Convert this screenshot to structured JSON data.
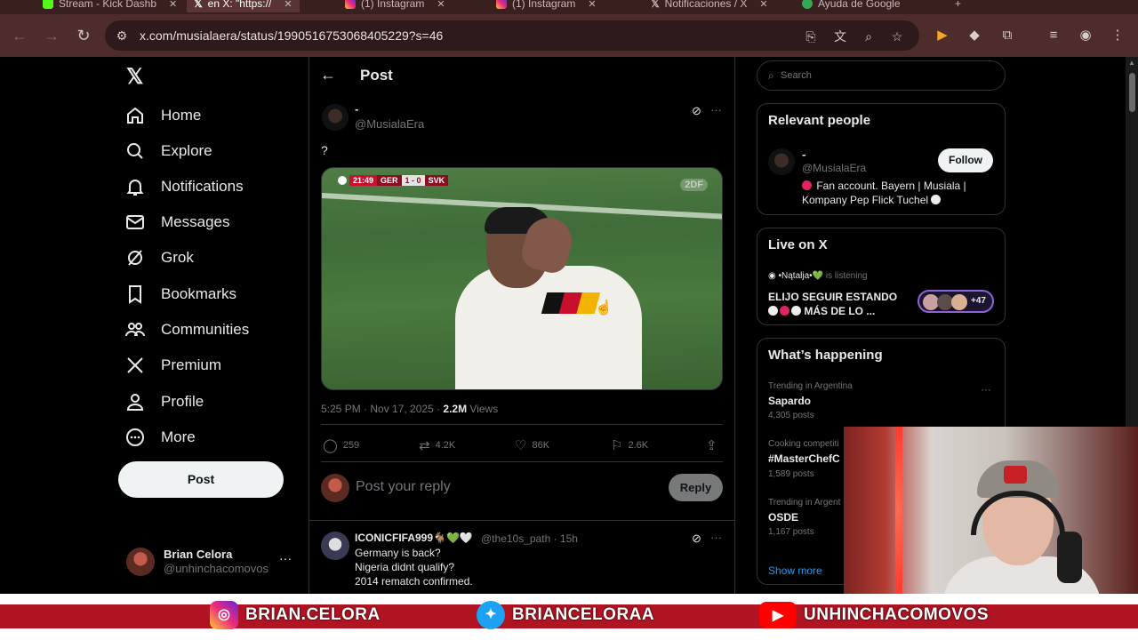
{
  "browser": {
    "tabs": [
      {
        "label": "Stream - Kick Dashb"
      },
      {
        "label": "en X: \"https://"
      },
      {
        "label": "(1) Instagram"
      },
      {
        "label": "(1) Instagram"
      },
      {
        "label": "Notificaciones / X"
      },
      {
        "label": "Ayuda de Google"
      }
    ],
    "url": "x.com/musialaera/status/1990516753068405229?s=46"
  },
  "nav": {
    "items": [
      {
        "label": "Home",
        "icon": "home-icon"
      },
      {
        "label": "Explore",
        "icon": "search-icon"
      },
      {
        "label": "Notifications",
        "icon": "bell-icon"
      },
      {
        "label": "Messages",
        "icon": "mail-icon"
      },
      {
        "label": "Grok",
        "icon": "grok-icon"
      },
      {
        "label": "Bookmarks",
        "icon": "bookmark-icon"
      },
      {
        "label": "Communities",
        "icon": "communities-icon"
      },
      {
        "label": "Premium",
        "icon": "x-logo-icon"
      },
      {
        "label": "Profile",
        "icon": "person-icon"
      },
      {
        "label": "More",
        "icon": "more-circle-icon"
      }
    ],
    "post_label": "Post",
    "account": {
      "name": "Brian Celora",
      "handle": "@unhinchacomovos",
      "more": "···"
    }
  },
  "post": {
    "header_title": "Post",
    "author_name": "-",
    "author_handle": "@MusialaEra",
    "text": "?",
    "media": {
      "score_time": "21:49",
      "team_home": "GER",
      "score": "1 - 0",
      "team_away": "SVK",
      "broadcaster": "2DF"
    },
    "timestamp": "5:25 PM · Nov 17, 2025 · ",
    "views_count": "2.2M",
    "views_label": " Views",
    "actions": {
      "replies": "259",
      "reposts": "4.2K",
      "likes": "86K",
      "bookmarks": "2.6K"
    },
    "reply_placeholder": "Post your reply",
    "reply_button": "Reply"
  },
  "comment": {
    "author_name": "ICONICFIFA999🐐💚🤍",
    "author_handle": "@the10s_path · 15h",
    "lines": [
      "Germany is back?",
      "Nigeria didnt qualify?",
      "2014 rematch confirmed."
    ]
  },
  "sidebar": {
    "search_placeholder": "Search",
    "relevant": {
      "title": "Relevant people",
      "name": "-",
      "handle": "@MusialaEra",
      "bio": "Fan account. Bayern | Musiala | Kompany Pep Flick Tuchel",
      "follow_label": "Follow"
    },
    "live": {
      "title": "Live on X",
      "host": "•Nątalja•💚",
      "status": "is listening",
      "space_title_1": "ELIJO SEGUIR ESTANDO",
      "space_title_2": "MÁS DE LO ...",
      "listeners": "+47"
    },
    "happening": {
      "title": "What’s happening",
      "trends": [
        {
          "context": "Trending in Argentina",
          "name": "Sapardo",
          "count": "4,305 posts"
        },
        {
          "context": "Cooking competiti",
          "name": "#MasterChefC",
          "count": "1,589 posts"
        },
        {
          "context": "Trending in Argent",
          "name": "OSDE",
          "count": "1,167 posts"
        }
      ],
      "show_more": "Show more"
    }
  },
  "banner": {
    "instagram": "BRIAN.CELORA",
    "twitter": "BRIANCELORAA",
    "youtube": "UNHINCHACOMOVOS"
  },
  "colors": {
    "accent": "#1d9bf0",
    "banner_red": "#b01322",
    "browser_frame": "#4e2c2c"
  }
}
